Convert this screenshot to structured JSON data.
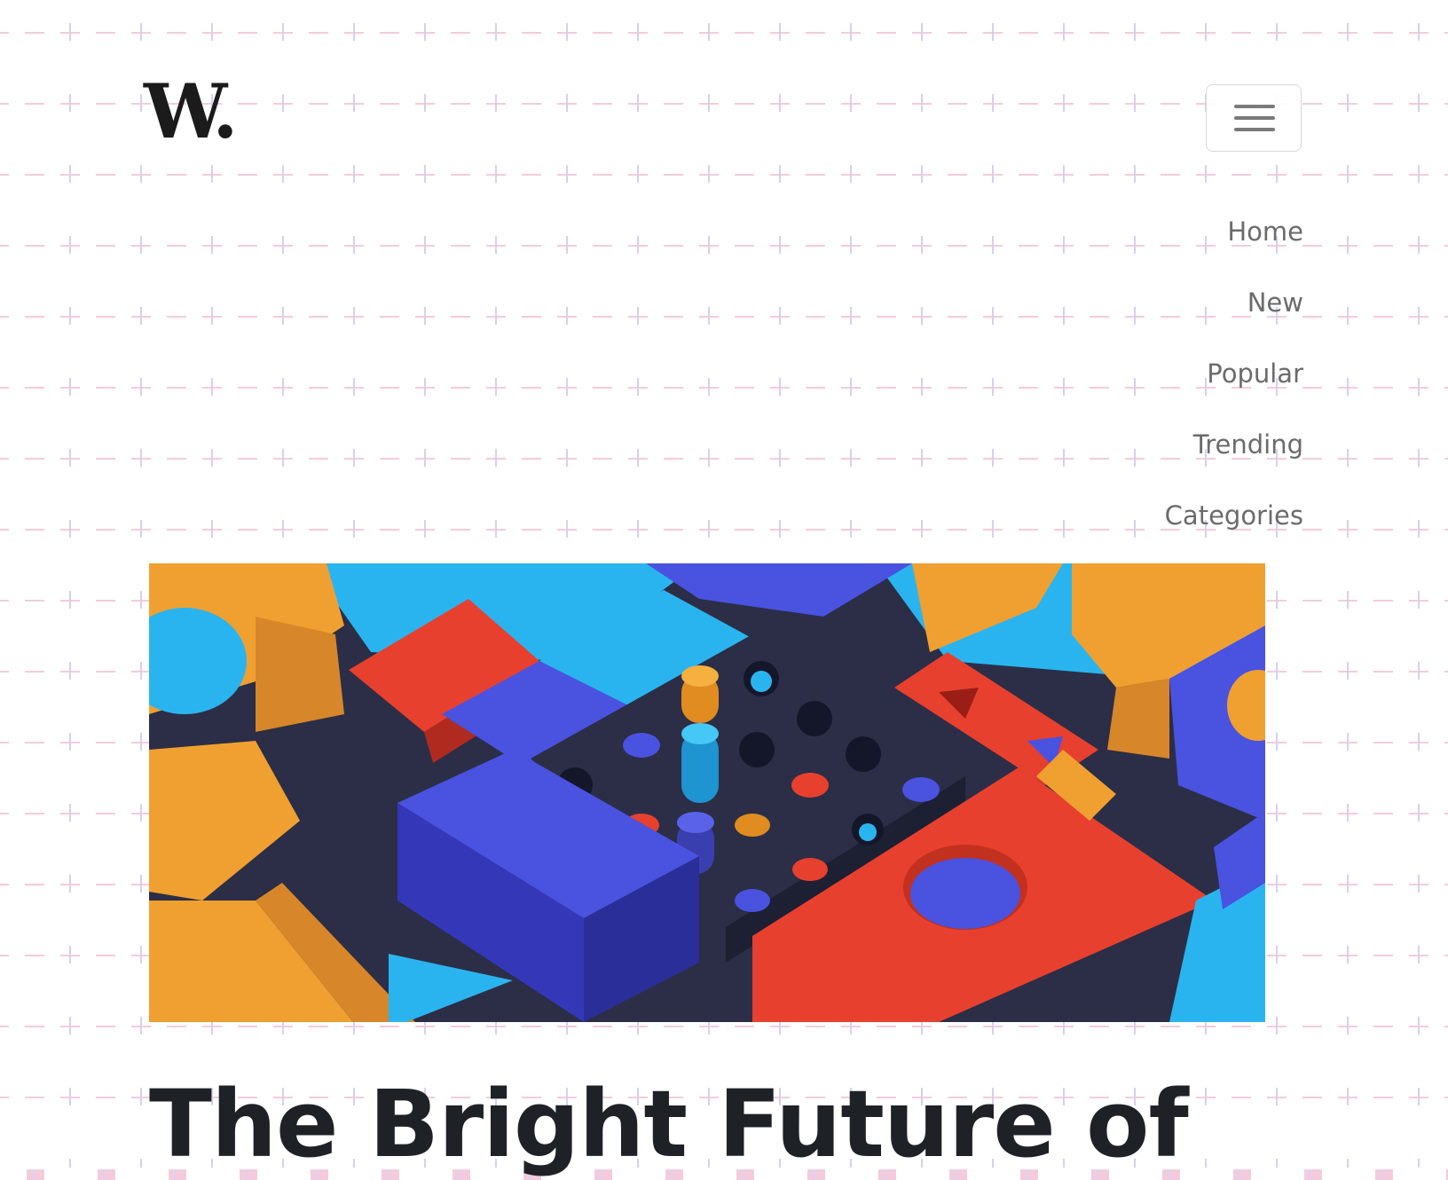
{
  "brand": {
    "logo_text": "W",
    "logo_dot": "."
  },
  "header": {
    "menu_button_icon": "hamburger-menu-icon"
  },
  "nav": {
    "items": [
      {
        "label": "Home"
      },
      {
        "label": "New"
      },
      {
        "label": "Popular"
      },
      {
        "label": "Trending"
      },
      {
        "label": "Categories"
      }
    ]
  },
  "hero": {
    "image_subject": "colorful 3D toy blocks with pegboard",
    "colors": {
      "orange": "#f0a030",
      "blue": "#4a52e0",
      "cyan": "#2ab4ef",
      "red": "#e8402e",
      "dark": "#2b2e46"
    }
  },
  "article": {
    "title": "The Bright Future of"
  },
  "theme": {
    "pattern_pink": "#f4cbdc",
    "pattern_lilac": "#d9d3f2",
    "text_dark": "#1e2227",
    "nav_gray": "#6b6b6b"
  }
}
